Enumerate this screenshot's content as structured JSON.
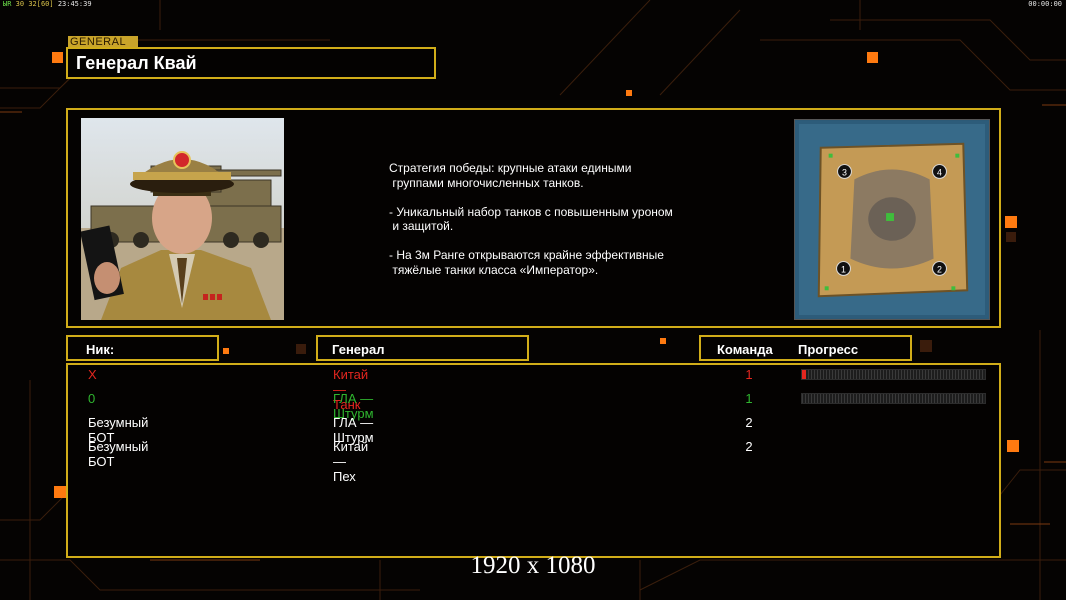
{
  "hud": {
    "left_prefix": "ЫR",
    "left_a": "30",
    "left_b": "32",
    "left_c": "[60]",
    "left_time": "23:45:39",
    "right_time": "00:00:00"
  },
  "general": {
    "tag": "GENERAL",
    "name": "Генерал Квай",
    "strategy": "Стратегия победы: крупные атаки едиными\n группами многочисленных танков.\n\n- Уникальный набор танков с повышенным уроном\n и защитой.\n\n- На 3м Ранге открываются крайне эффективные\n тяжёлые танки класса «Император»."
  },
  "minimap": {
    "spawns": [
      "1",
      "2",
      "3",
      "4"
    ]
  },
  "table": {
    "headers": {
      "nick": "Ник:",
      "general": "Генерал",
      "team": "Команда",
      "progress": "Прогресс"
    },
    "rows": [
      {
        "nick": "X",
        "general": "Китай — Танк",
        "team": "1",
        "color": "#e3261f",
        "progress": 0.02
      },
      {
        "nick": "0",
        "general": "ГЛА — Штурм",
        "team": "1",
        "color": "#2fb52f",
        "progress": 0
      },
      {
        "nick": "Безумный БОТ",
        "general": "ГЛА — Штурм",
        "team": "2",
        "color": "#ffffff"
      },
      {
        "nick": "Безумный БОТ",
        "general": "Китай — Пех",
        "team": "2",
        "color": "#ffffff"
      }
    ]
  },
  "resolution_label": "1920 x 1080",
  "colors": {
    "frame": "#d1ad19",
    "accent_orange": "#ff7a10"
  }
}
